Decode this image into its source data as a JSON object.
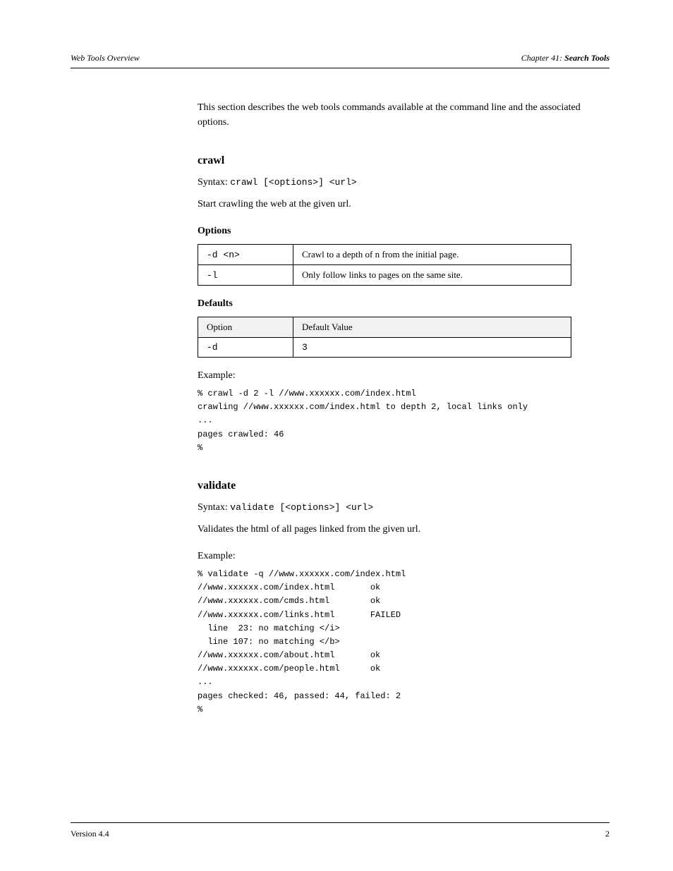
{
  "header": {
    "left": "Web Tools Overview",
    "right_italic": "Chapter 41: ",
    "right_bold": "Search Tools"
  },
  "intro": "This section describes the web tools commands available at the command line and the associated options.",
  "crawl": {
    "heading": "crawl",
    "syntax_label": "Syntax: ",
    "syntax_code": "crawl [<options>] <url>",
    "desc": "Start crawling the web at the given url.",
    "options_heading": "Options",
    "options": [
      {
        "flag": "-d <n>",
        "desc": "Crawl to a depth of n from the initial page."
      },
      {
        "flag": "-l",
        "desc": "Only follow links to pages on the same site."
      }
    ],
    "defaults_heading": "Defaults",
    "defaults": [
      {
        "header_option": "Option",
        "header_default": "Default Value"
      },
      {
        "flag": "-d",
        "value": "3"
      }
    ],
    "example_label": "Example:",
    "example_code": "% crawl -d 2 -l //www.xxxxxx.com/index.html\ncrawling //www.xxxxxx.com/index.html to depth 2, local links only\n...\npages crawled: 46\n%"
  },
  "validate": {
    "heading": "validate",
    "syntax_label": "Syntax: ",
    "syntax_code": "validate [<options>] <url>",
    "desc": "Validates the html of all pages linked from the given url.",
    "example_label": "Example:",
    "example_code": "% validate -q //www.xxxxxx.com/index.html\n//www.xxxxxx.com/index.html       ok\n//www.xxxxxx.com/cmds.html        ok\n//www.xxxxxx.com/links.html       FAILED\n  line  23: no matching </i>\n  line 107: no matching </b>\n//www.xxxxxx.com/about.html       ok\n//www.xxxxxx.com/people.html      ok\n...\npages checked: 46, passed: 44, failed: 2\n%"
  },
  "footer": {
    "left": "Version 4.4",
    "right": "2"
  }
}
